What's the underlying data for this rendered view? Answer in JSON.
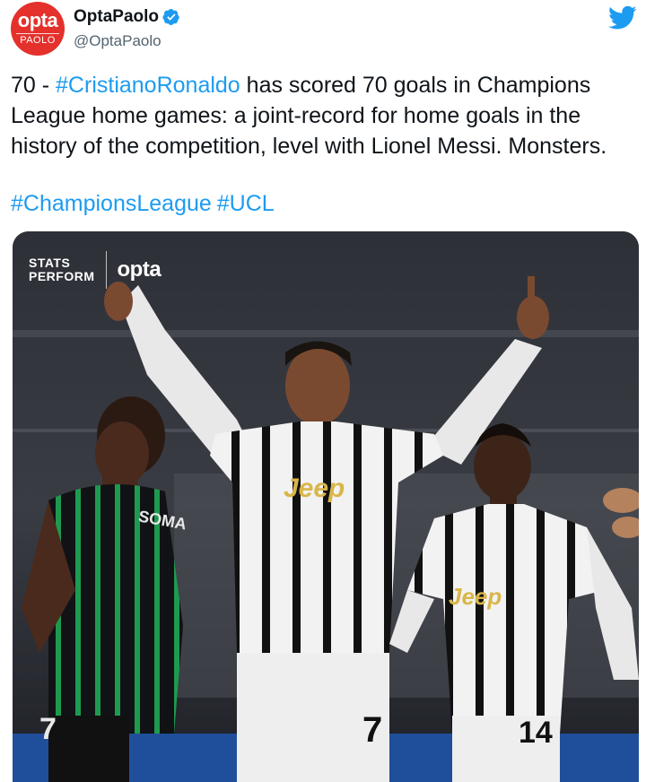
{
  "account": {
    "display_name": "OptaPaolo",
    "handle": "@OptaPaolo",
    "avatar_top": "opta",
    "avatar_bottom": "PAOLO"
  },
  "tweet": {
    "text_prefix": "70 - ",
    "hashtag_1": "#CristianoRonaldo",
    "text_main": " has scored 70 goals in Champions League home games: a joint-record for home goals in the history of the competition, level with Lionel Messi. Monsters.",
    "tags": [
      "#ChampionsLeague",
      "#UCL"
    ]
  },
  "media": {
    "brand_line_1": "STATS",
    "brand_line_2": "PERFORM",
    "brand_opta": "opta",
    "player_left_name": "SOMA",
    "player_left_number": "7",
    "player_center_number": "7",
    "player_right_number": "14",
    "sponsor": "Jeep"
  },
  "icons": {
    "verified": "verified-badge-icon",
    "platform": "twitter-bird-icon"
  },
  "colors": {
    "accent": "#1d9bf0",
    "opta_red": "#e4312b",
    "text": "#0f1419",
    "muted": "#536471"
  }
}
